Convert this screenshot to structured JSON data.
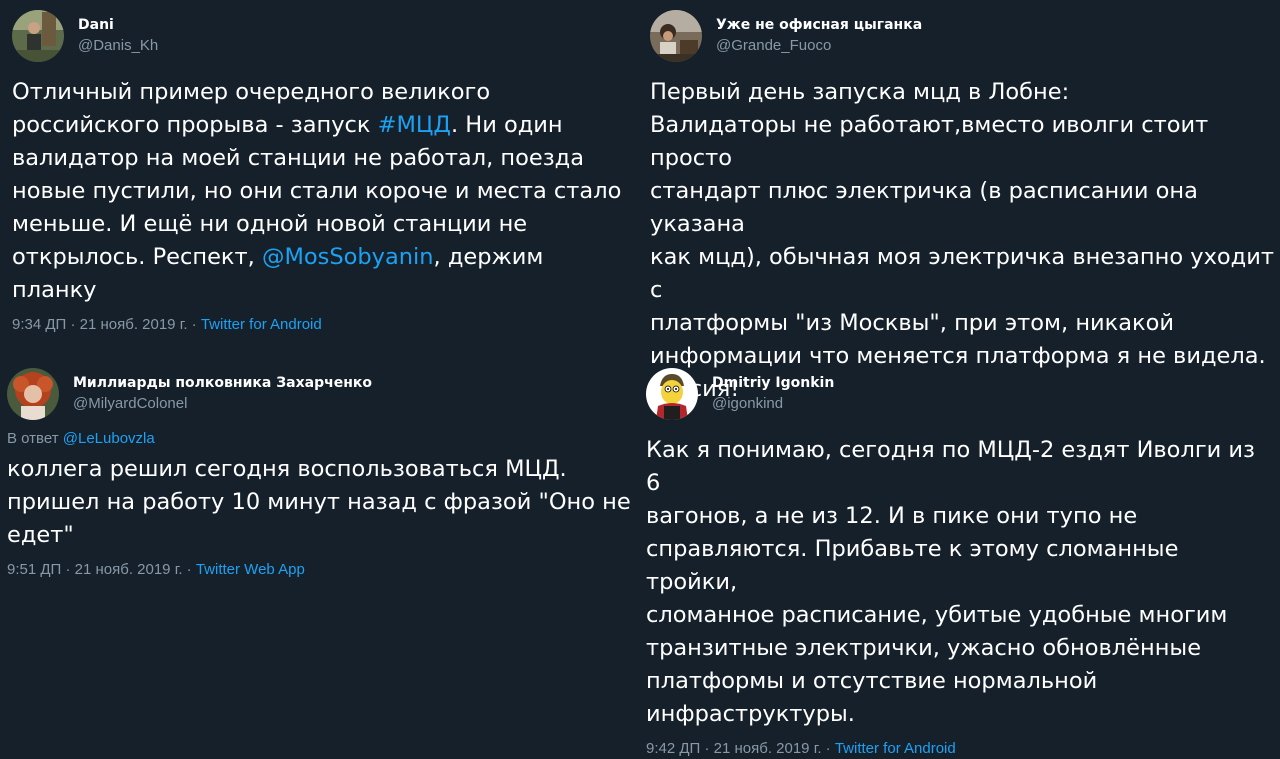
{
  "tweets": [
    {
      "name": "Dani",
      "handle": "@Danis_Kh",
      "body_lines": [
        [
          {
            "t": "Отличный пример очередного великого"
          }
        ],
        [
          {
            "t": "российского прорыва - запуск "
          },
          {
            "t": "#МЦД",
            "link": true
          },
          {
            "t": ". Ни один"
          }
        ],
        [
          {
            "t": "валидатор на моей станции не работал, поезда"
          }
        ],
        [
          {
            "t": "новые пустили, но они стали короче и места стало"
          }
        ],
        [
          {
            "t": "меньше. И ещё ни одной новой станции не"
          }
        ],
        [
          {
            "t": "открылось. Респект, "
          },
          {
            "t": "@MosSobyanin",
            "link": true
          },
          {
            "t": ", держим планку"
          }
        ]
      ],
      "time": "9:34 ДП · 21 нояб. 2019 г. · ",
      "source": "Twitter for Android"
    },
    {
      "name": "Уже не офисная цыганка",
      "handle": "@Grande_Fuoco",
      "body_lines": [
        [
          {
            "t": "Первый день запуска мцд в Лобне:"
          }
        ],
        [
          {
            "t": "Валидаторы не работают,вместо иволги стоит просто"
          }
        ],
        [
          {
            "t": "стандарт плюс электричка (в расписании она указана"
          }
        ],
        [
          {
            "t": "как мцд), обычная моя электричка внезапно уходит с"
          }
        ],
        [
          {
            "t": "платформы \"из Москвы\", при этом, никакой"
          }
        ],
        [
          {
            "t": "информации что меняется платформа я не видела."
          }
        ],
        [
          {
            "t": "Россия!"
          }
        ]
      ],
      "time": "",
      "source": ""
    },
    {
      "name": "Миллиарды полковника Захарченко",
      "handle": "@MilyardColonel",
      "reply_prefix": "В ответ ",
      "reply_to": "@LeLubovzla",
      "body_lines": [
        [
          {
            "t": "коллега решил сегодня воспользоваться МЦД."
          }
        ],
        [
          {
            "t": "пришел на работу 10 минут назад с фразой \"Оно не"
          }
        ],
        [
          {
            "t": "едет\""
          }
        ]
      ],
      "time": "9:51 ДП · 21 нояб. 2019 г. · ",
      "source": "Twitter Web App"
    },
    {
      "name": "Dmitriy Igonkin",
      "handle": "@igonkind",
      "body_lines": [
        [
          {
            "t": "Как я понимаю, сегодня по МЦД-2 ездят Иволги из 6"
          }
        ],
        [
          {
            "t": "вагонов, а не из 12. И в пике они тупо не"
          }
        ],
        [
          {
            "t": "справляются. Прибавьте к этому сломанные тройки,"
          }
        ],
        [
          {
            "t": "сломанное расписание, убитые удобные многим"
          }
        ],
        [
          {
            "t": "транзитные электрички, ужасно обновлённые"
          }
        ],
        [
          {
            "t": "платформы и отсутствие нормальной"
          }
        ],
        [
          {
            "t": "инфраструктуры."
          }
        ]
      ],
      "time": "9:42 ДП · 21 нояб. 2019 г. · ",
      "source": "Twitter for Android"
    }
  ],
  "colors": {
    "background": "#15202b",
    "text": "#ffffff",
    "secondary": "#8899a6",
    "link": "#1da1f2"
  }
}
